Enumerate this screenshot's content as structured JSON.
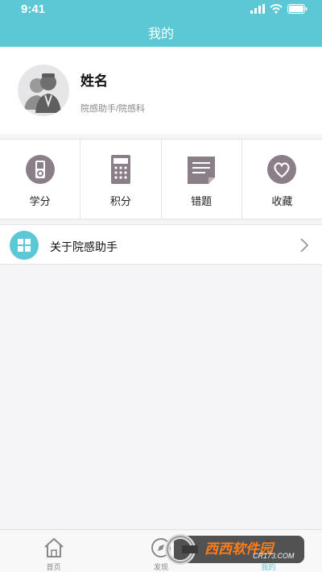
{
  "status_bar": {
    "time": "9:41"
  },
  "header": {
    "title": "我的"
  },
  "profile": {
    "name": "姓名",
    "subtitle": "院感助手/院感科"
  },
  "grid": [
    {
      "label": "学分",
      "icon": "medal-icon"
    },
    {
      "label": "积分",
      "icon": "calculator-icon"
    },
    {
      "label": "错题",
      "icon": "document-icon"
    },
    {
      "label": "收藏",
      "icon": "heart-icon"
    }
  ],
  "about": {
    "label": "关于院感助手",
    "icon": "grid-squares-icon"
  },
  "tabbar": {
    "items": [
      {
        "label": "首页",
        "icon": "home-icon",
        "active": false
      },
      {
        "label": "发现",
        "icon": "compass-icon",
        "active": false
      },
      {
        "label": "我的",
        "icon": "profile-icon",
        "active": true
      }
    ]
  },
  "watermark": {
    "text": "西西软件园",
    "url": "CR173.COM"
  },
  "colors": {
    "accent": "#5cc8d6",
    "icon_gray": "#8a7f89",
    "background": "#f5f5f7"
  }
}
